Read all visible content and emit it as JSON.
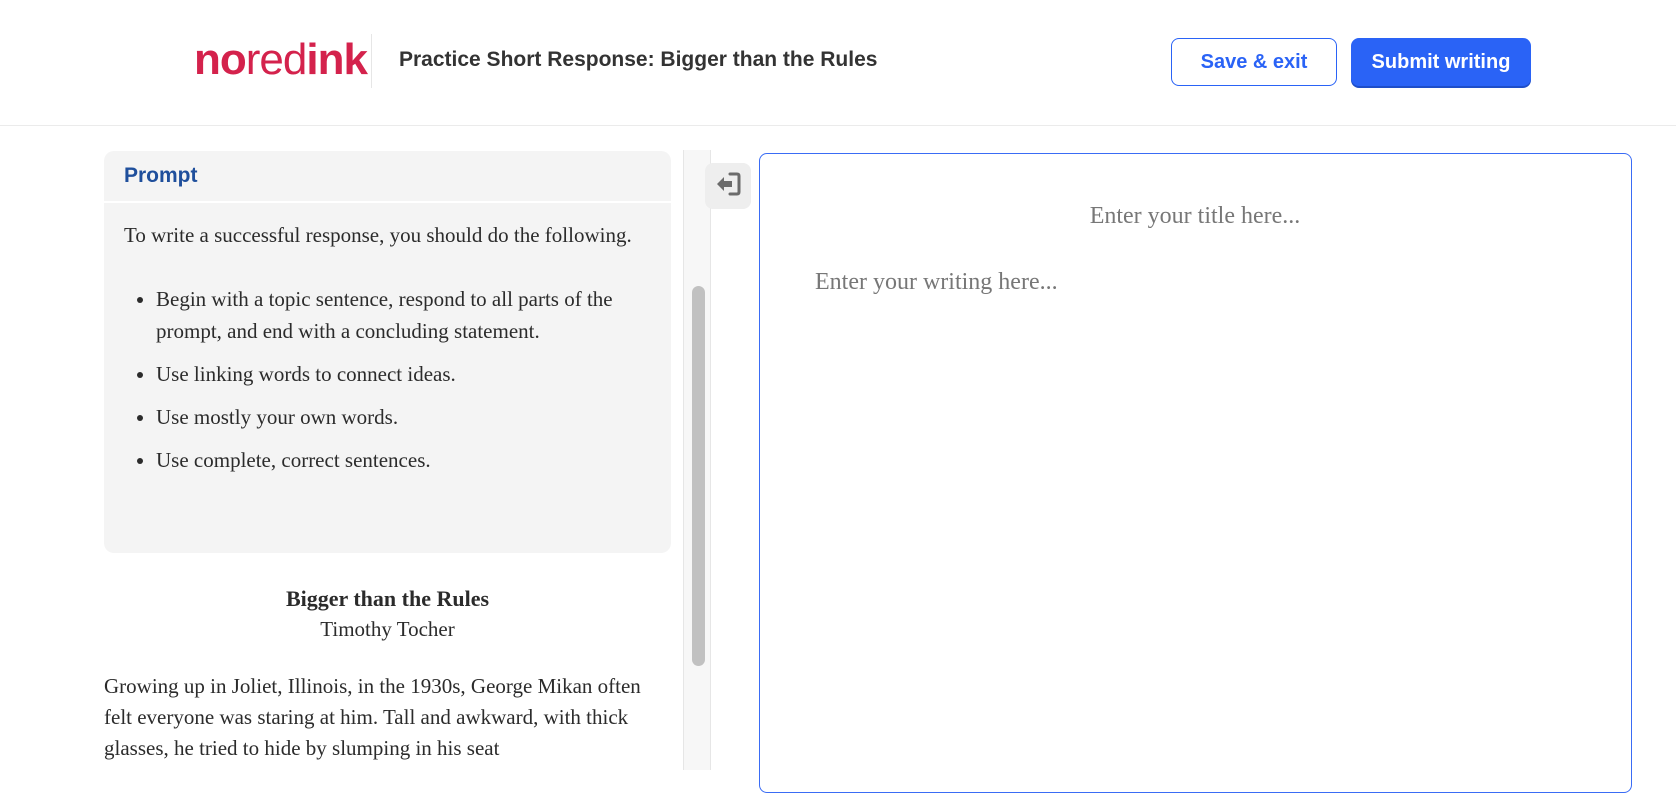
{
  "header": {
    "logo": {
      "part1": "no",
      "part2": "red",
      "part3": "ink"
    },
    "title": "Practice Short Response: Bigger than the Rules",
    "save_label": "Save & exit",
    "submit_label": "Submit writing"
  },
  "prompt": {
    "heading": "Prompt",
    "intro": "To write a successful response, you should do the following.",
    "items": [
      "Begin with a topic sentence, respond to all parts of the prompt, and end with a concluding statement.",
      "Use linking words to connect ideas.",
      "Use mostly your own words.",
      "Use complete, correct sentences."
    ]
  },
  "passage": {
    "title": "Bigger than the Rules",
    "author": "Timothy Tocher",
    "text": "Growing up in Joliet, Illinois, in the 1930s, George Mikan often felt everyone was staring at him. Tall and awkward, with thick glasses, he tried to hide by slumping in his seat"
  },
  "editor": {
    "title_placeholder": "Enter your title here...",
    "body_placeholder": "Enter your writing here..."
  },
  "icons": {
    "collapse": "arrow-into-door-icon"
  },
  "colors": {
    "brand": "#d4224c",
    "accent": "#2a63f6",
    "prompt_heading": "#1f4f9c"
  }
}
